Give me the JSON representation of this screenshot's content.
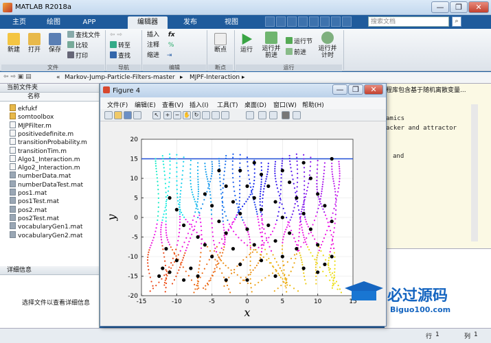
{
  "window": {
    "title": "MATLAB R2018a",
    "controls": [
      "—",
      "❐",
      "✕"
    ]
  },
  "tabs": [
    "主页",
    "绘图",
    "APP",
    "编辑器",
    "发布",
    "视图"
  ],
  "active_tab": "编辑器",
  "search": {
    "placeholder": "搜索文档"
  },
  "ribbon": {
    "new": "新建",
    "open": "打开",
    "save": "保存",
    "find_files": "查找文件",
    "compare": "比较",
    "print": "打印",
    "goto": "转至",
    "find": "查找",
    "insert": "插入",
    "comment": "注释",
    "indent": "缩进",
    "breakpoints": "断点",
    "run": "运行",
    "run_advance_l1": "运行并",
    "run_advance_l2": "前进",
    "run_section": "运行节",
    "advance": "前进",
    "run_time_l1": "运行并",
    "run_time_l2": "计时",
    "sections": [
      "文件",
      "导航",
      "编辑",
      "断点",
      "运行"
    ]
  },
  "address": {
    "path": [
      "«",
      "Markov-Jump-Particle-Filters-master",
      "▸",
      "MJPF-Interaction",
      "▸"
    ]
  },
  "left_panel": {
    "header": "当前文件夹",
    "column": "名称",
    "files": [
      "ekfukf",
      "somtoolbox",
      "MJPFilter.m",
      "positivedefinite.m",
      "transitionProbability.m",
      "transitionTim.m",
      "Algo1_Interaction.m",
      "Algo2_Interaction.m",
      "numberData.mat",
      "numberDataTest.mat",
      "pos1.mat",
      "pos1Test.mat",
      "pos2.mat",
      "pos2Test.mat",
      "vocabularyGen1.mat",
      "vocabularyGen2.mat"
    ],
    "details_header": "详细信息",
    "details_text": "选择文件以查看详细信息"
  },
  "editor": {
    "lines": [
      "amics",
      "acker and attractor",
      "and"
    ],
    "top_text": "程库包含基于随机离散变量..."
  },
  "status": {
    "row_label": "行",
    "row": "1",
    "col_label": "列",
    "col": "1"
  },
  "figure": {
    "title": "Figure 4",
    "menus": [
      "文件(F)",
      "编辑(E)",
      "查看(V)",
      "插入(I)",
      "工具(T)",
      "桌面(D)",
      "窗口(W)",
      "帮助(H)"
    ]
  },
  "colors": {
    "ribbon_blue": "#1f5b9c",
    "editor_bg": "#fbf9e4",
    "plot_line": "#1f4fd6"
  },
  "chart_data": {
    "type": "scatter",
    "xlabel": "x",
    "ylabel": "y",
    "xlim": [
      -15,
      15
    ],
    "ylim": [
      -20,
      20
    ],
    "xticks": [
      -15,
      -10,
      -5,
      0,
      5,
      10,
      15
    ],
    "yticks": [
      -20,
      -15,
      -10,
      -5,
      0,
      5,
      10,
      15,
      20
    ],
    "grid": true,
    "reference_line": {
      "x": [
        -15,
        15
      ],
      "y": [
        15,
        15
      ]
    },
    "trajectory_starts": [
      -13,
      -12,
      -11,
      -10,
      -9,
      -8,
      -7,
      -6,
      -5,
      -4,
      -3,
      -2,
      -1,
      0,
      1,
      2,
      3,
      4,
      5,
      6,
      7,
      8,
      9,
      10,
      11,
      12,
      13
    ],
    "black_markers": [
      [
        -12.5,
        -15
      ],
      [
        -11,
        5
      ],
      [
        -11.5,
        -8
      ],
      [
        -12,
        -13
      ],
      [
        -11,
        -14
      ],
      [
        -10,
        -11
      ],
      [
        -9,
        -16
      ],
      [
        -8,
        -13
      ],
      [
        -10,
        2
      ],
      [
        -9,
        -2
      ],
      [
        -7,
        -5
      ],
      [
        -6,
        -7
      ],
      [
        -5,
        -10
      ],
      [
        -7,
        -15
      ],
      [
        -6,
        6
      ],
      [
        -5,
        3
      ],
      [
        -4,
        -1
      ],
      [
        -3,
        -4
      ],
      [
        -2,
        -8
      ],
      [
        -1,
        -12
      ],
      [
        -3,
        -16
      ],
      [
        -4,
        12
      ],
      [
        -3,
        8
      ],
      [
        -2,
        4
      ],
      [
        -1,
        1
      ],
      [
        0,
        -3
      ],
      [
        1,
        -7
      ],
      [
        2,
        -11
      ],
      [
        0,
        -16
      ],
      [
        -1,
        12
      ],
      [
        0,
        8
      ],
      [
        1,
        5
      ],
      [
        2,
        2
      ],
      [
        3,
        -2
      ],
      [
        4,
        -6
      ],
      [
        5,
        -10
      ],
      [
        4,
        -15
      ],
      [
        1,
        14
      ],
      [
        2,
        11
      ],
      [
        3,
        8
      ],
      [
        4,
        4
      ],
      [
        5,
        0
      ],
      [
        6,
        -4
      ],
      [
        7,
        -8
      ],
      [
        8,
        -13
      ],
      [
        5,
        12
      ],
      [
        6,
        9
      ],
      [
        7,
        5
      ],
      [
        8,
        1
      ],
      [
        9,
        -3
      ],
      [
        10,
        -7
      ],
      [
        11,
        -12
      ],
      [
        8,
        14
      ],
      [
        9,
        10
      ],
      [
        10,
        6
      ],
      [
        11,
        3
      ],
      [
        12,
        -1
      ],
      [
        12,
        -10
      ],
      [
        10,
        -14
      ],
      [
        12,
        15
      ]
    ]
  }
}
